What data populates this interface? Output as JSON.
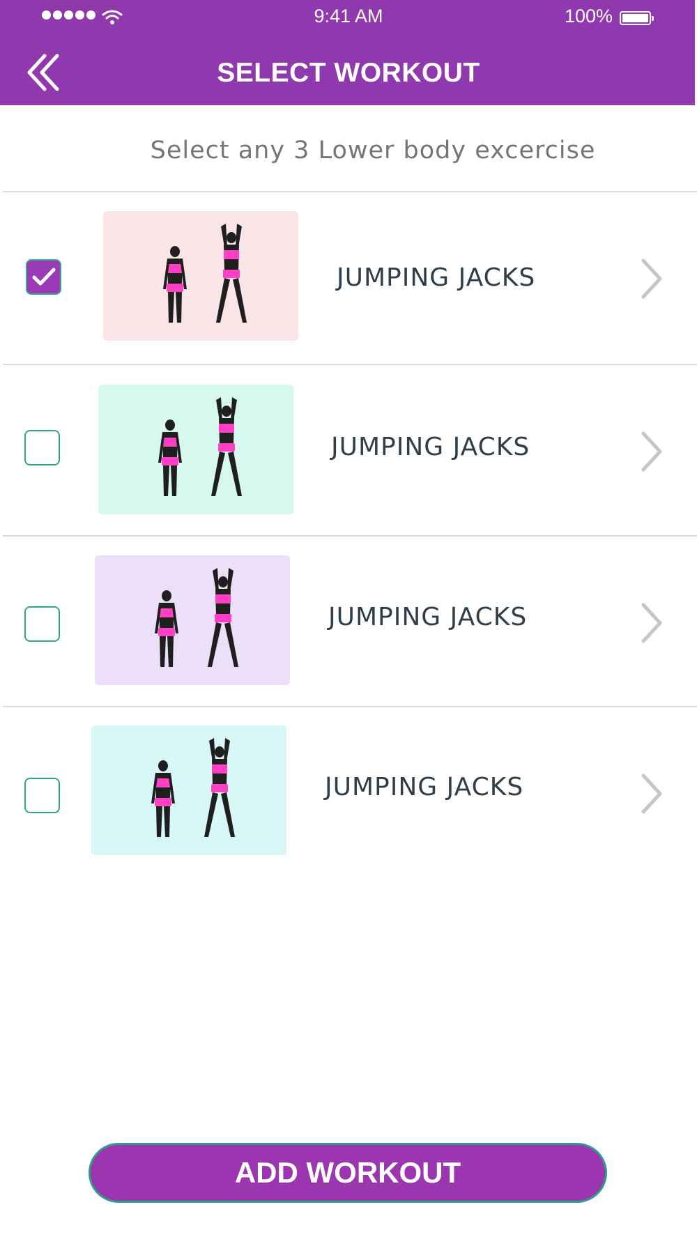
{
  "status_bar": {
    "time": "9:41 AM",
    "battery": "100%"
  },
  "header": {
    "title": "SELECT WORKOUT"
  },
  "subtitle": "Select any 3 Lower body excercise",
  "workouts": [
    {
      "label": "JUMPING JACKS",
      "checked": true,
      "thumb_color": "#f9e4e8"
    },
    {
      "label": "JUMPING JACKS",
      "checked": false,
      "thumb_color": "#d6f8ee"
    },
    {
      "label": "JUMPING JACKS",
      "checked": false,
      "thumb_color": "#ecdff8"
    },
    {
      "label": "JUMPING JACKS",
      "checked": false,
      "thumb_color": "#d8f8f8"
    }
  ],
  "add_button": {
    "label": "ADD WORKOUT"
  },
  "colors": {
    "header": "#9038ad",
    "accent": "#9c36b0",
    "checkbox_border": "#36a48a",
    "figure_pink": "#ff3fc4"
  }
}
